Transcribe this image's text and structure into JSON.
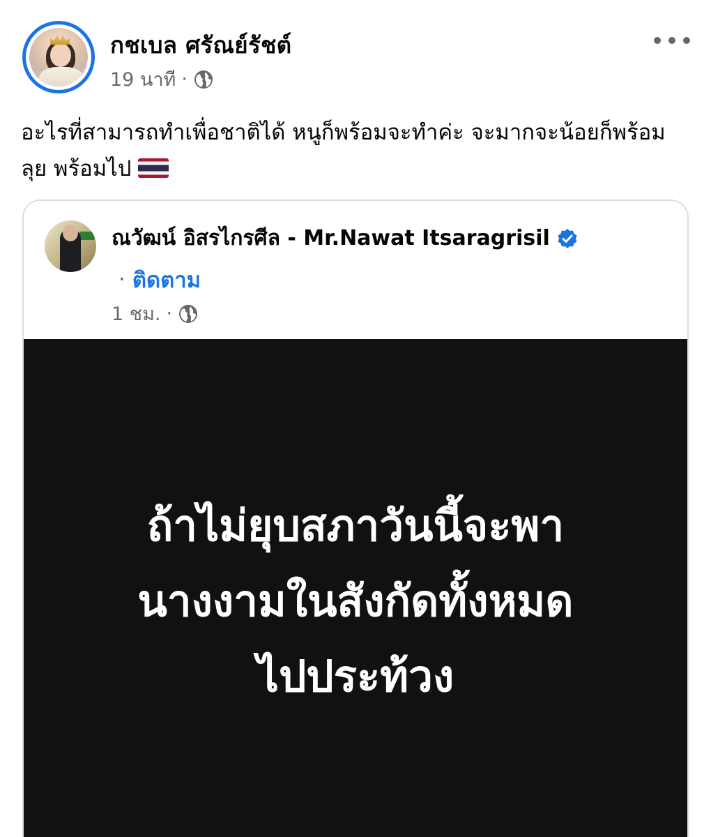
{
  "post": {
    "author_name": "กชเบล ศรัณย์รัชต์",
    "time": "19 นาที",
    "separator": "·",
    "visibility_icon": "globe-icon",
    "more_icon": "more-dots-icon",
    "text": "อะไรที่สามารถทำเพื่อชาติได้ หนูก็พร้อมจะทำค่ะ จะมากจะน้อยก็พร้อมลุย พร้อมไป",
    "emoji": "thailand-flag-icon"
  },
  "shared_post": {
    "author_name": "ณวัฒน์ อิสรไกรศีล - Mr.Nawat Itsaragrisil",
    "verified_icon": "verified-badge-icon",
    "follow_separator": "·",
    "follow_label": "ติดตาม",
    "time": "1 ชม.",
    "separator": "·",
    "visibility_icon": "globe-icon",
    "image_text": [
      "ถ้าไม่ยุบสภาวันนี้จะพา",
      "นางงามในสังกัดทั้งหมด",
      "ไปประท้วง"
    ],
    "image_background": "#111111"
  },
  "colors": {
    "accent": "#1b74e4",
    "secondary_text": "#65676b",
    "card_border": "#dadde1"
  }
}
